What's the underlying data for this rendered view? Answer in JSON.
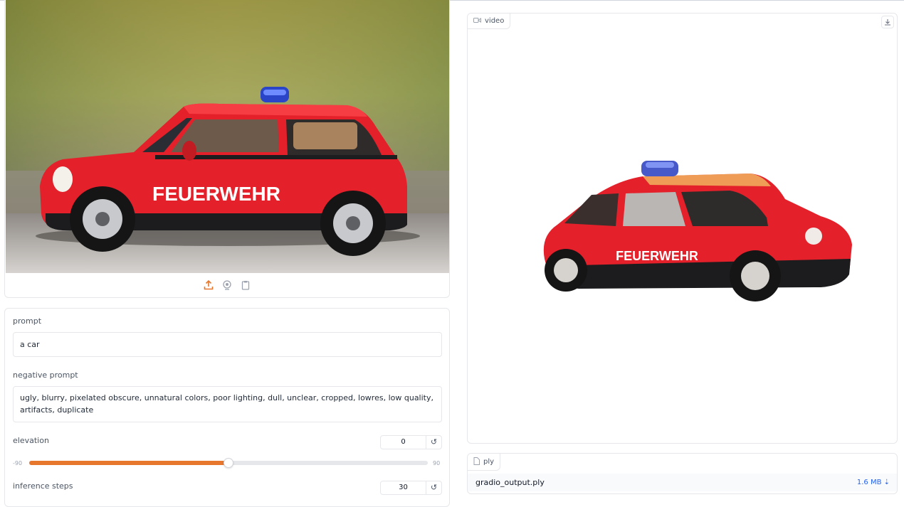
{
  "input_image": {
    "alt": "toy fire car photo",
    "car_text": "FEUERWEHR",
    "tools": [
      {
        "name": "upload-icon"
      },
      {
        "name": "webcam-icon"
      },
      {
        "name": "clipboard-icon"
      }
    ]
  },
  "params": {
    "prompt_label": "prompt",
    "prompt_value": "a car",
    "negative_label": "negative prompt",
    "negative_value": "ugly, blurry, pixelated obscure, unnatural colors, poor lighting, dull, unclear, cropped, lowres, low quality, artifacts, duplicate",
    "elevation_label": "elevation",
    "elevation_value": "0",
    "elevation_min": "-90",
    "elevation_max": "90",
    "elevation_fraction": 0.5,
    "steps_label": "inference steps",
    "steps_value": "30",
    "reset_glyph": "↺"
  },
  "video": {
    "label": "video",
    "car_text": "FEUERWEHR"
  },
  "ply": {
    "label": "ply",
    "filename": "gradio_output.ply",
    "size": "1.6 MB ⇣"
  },
  "colors": {
    "accent": "#e8772e",
    "car_red": "#e4202a",
    "link_blue": "#2563eb"
  }
}
